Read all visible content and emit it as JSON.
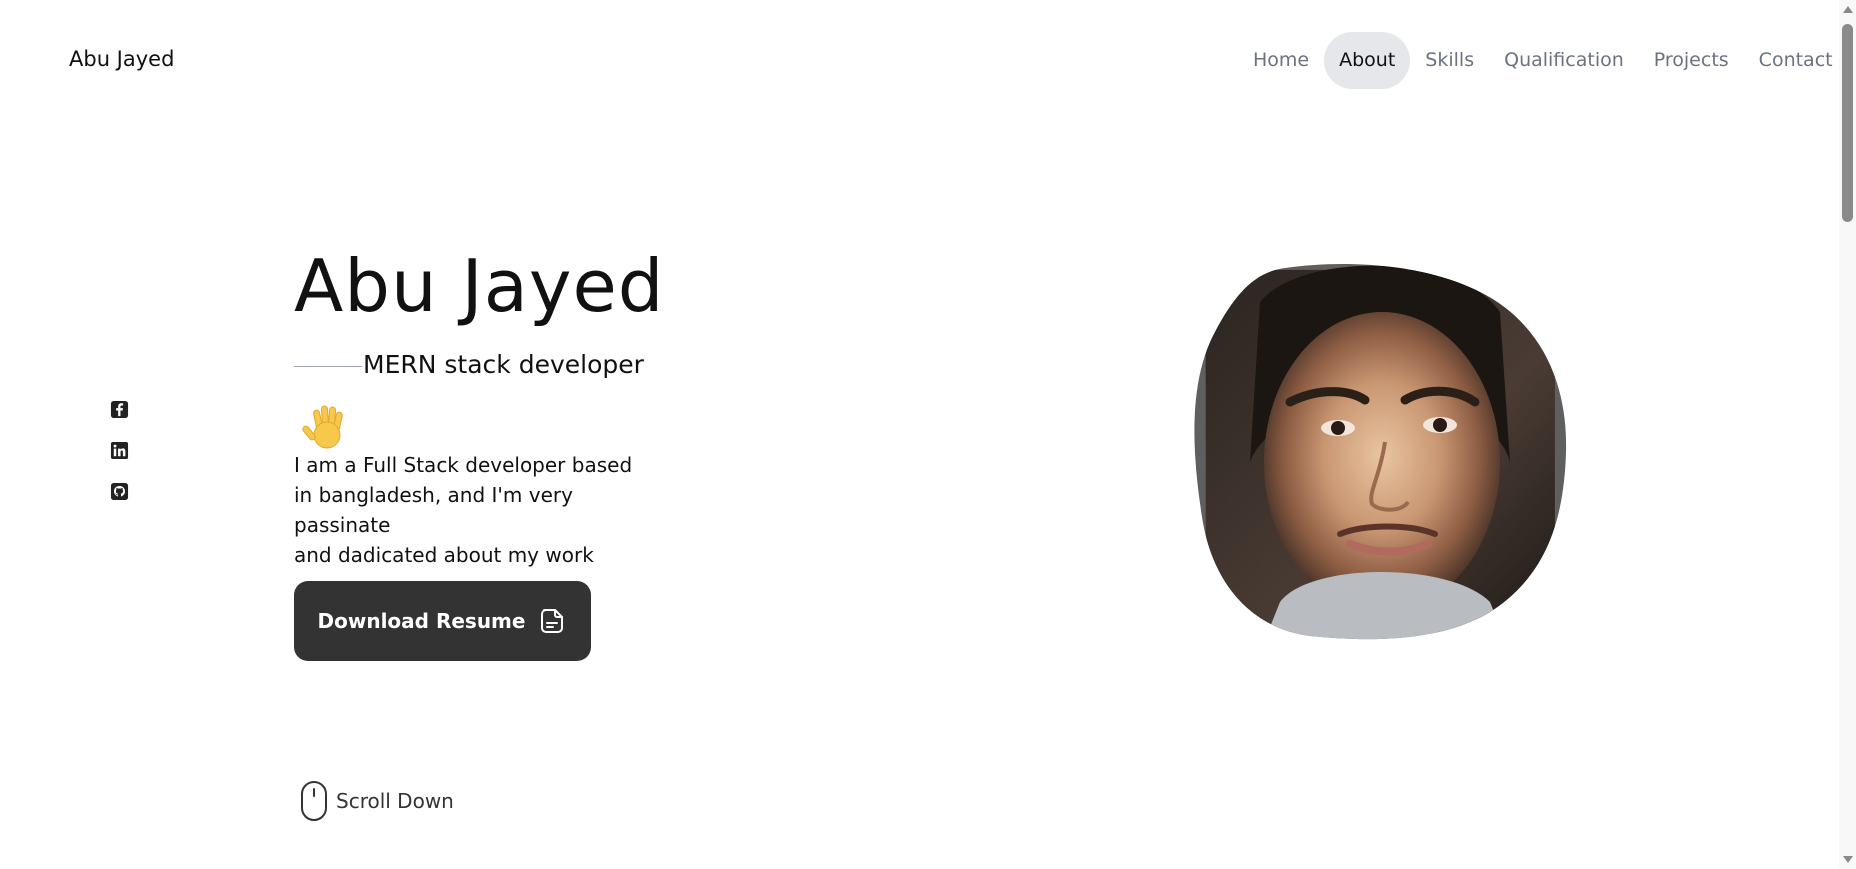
{
  "header": {
    "brand": "Abu Jayed",
    "nav": [
      {
        "label": "Home",
        "active": false
      },
      {
        "label": "About",
        "active": true
      },
      {
        "label": "Skills",
        "active": false
      },
      {
        "label": "Qualification",
        "active": false
      },
      {
        "label": "Projects",
        "active": false
      },
      {
        "label": "Contact",
        "active": false
      }
    ]
  },
  "social": {
    "icons": [
      "facebook-icon",
      "linkedin-icon",
      "github-icon"
    ]
  },
  "hero": {
    "name": "Abu Jayed",
    "subtitle": "MERN stack developer",
    "wave_icon": "waving-hand-icon",
    "description_lines": [
      "I am a Full Stack developer based",
      "in bangladesh, and I'm very passinate",
      "and dadicated about my work"
    ],
    "download_label": "Download Resume",
    "download_icon": "document-icon"
  },
  "scroll": {
    "label": "Scroll Down",
    "icon": "mouse-icon"
  },
  "colors": {
    "button_bg": "#333333",
    "nav_active_bg": "#e5e7eb",
    "nav_text": "#6b7280",
    "blob_border": "#5f5f5f"
  }
}
